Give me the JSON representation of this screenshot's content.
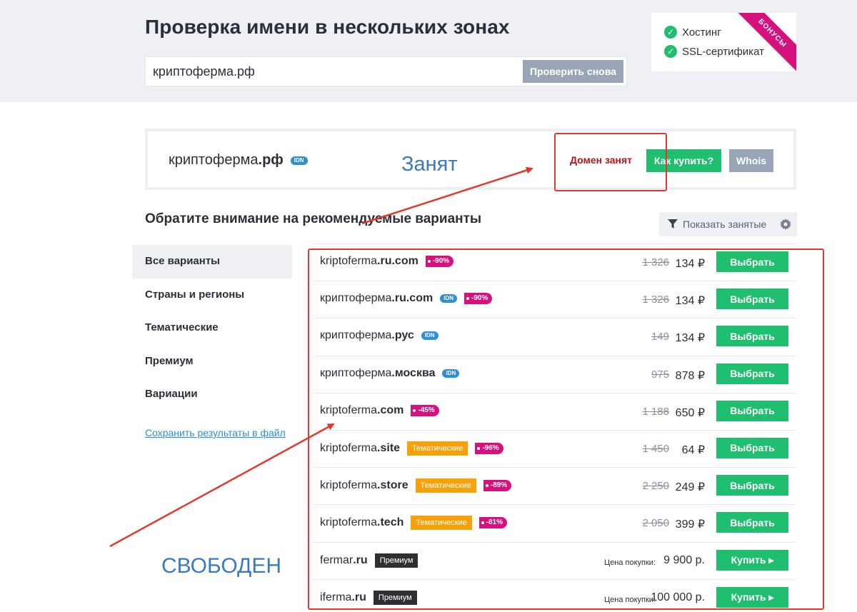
{
  "header": {
    "title": "Проверка имени в нескольких зонах",
    "search_value": "криптоферма.рф",
    "recheck_label": "Проверить снова"
  },
  "bonus": {
    "items": [
      "Хостинг",
      "SSL-сертификат"
    ],
    "ribbon": "БОНУСЫ"
  },
  "result": {
    "domain_name": "криптоферма",
    "domain_zone": ".рф",
    "idn": "IDN",
    "status": "Домен занят",
    "howbuy_label": "Как купить?",
    "whois_label": "Whois"
  },
  "recommend": {
    "title": "Обратите внимание на рекомендуемые варианты",
    "show_taken": "Показать занятые"
  },
  "sidebar": {
    "items": [
      "Все варианты",
      "Страны и регионы",
      "Тематические",
      "Премиум",
      "Вариации"
    ],
    "save_link": "Сохранить результаты в файл"
  },
  "rows": [
    {
      "name": "kriptoferma",
      "zone": ".ru.com",
      "tags": [
        {
          "type": "disc",
          "text": "-90%"
        }
      ],
      "old": "1 326",
      "price": "134 ₽",
      "btn": "Выбрать"
    },
    {
      "name": "криптоферма",
      "zone": ".ru.com",
      "tags": [
        {
          "type": "idn2",
          "text": "IDN"
        },
        {
          "type": "disc",
          "text": "-90%"
        }
      ],
      "old": "1 326",
      "price": "134 ₽",
      "btn": "Выбрать"
    },
    {
      "name": "криптоферма",
      "zone": ".рус",
      "tags": [
        {
          "type": "idn2",
          "text": "IDN"
        }
      ],
      "old": "149",
      "price": "134 ₽",
      "btn": "Выбрать"
    },
    {
      "name": "криптоферма",
      "zone": ".москва",
      "tags": [
        {
          "type": "idn2",
          "text": "IDN"
        }
      ],
      "old": "975",
      "price": "878 ₽",
      "btn": "Выбрать"
    },
    {
      "name": "kriptoferma",
      "zone": ".com",
      "tags": [
        {
          "type": "disc",
          "text": "-45%"
        }
      ],
      "old": "1 188",
      "price": "650 ₽",
      "btn": "Выбрать"
    },
    {
      "name": "kriptoferma",
      "zone": ".site",
      "tags": [
        {
          "type": "theme",
          "text": "Тематические"
        },
        {
          "type": "disc",
          "text": "-96%"
        }
      ],
      "old": "1 450",
      "price": "64 ₽",
      "btn": "Выбрать"
    },
    {
      "name": "kriptoferma",
      "zone": ".store",
      "tags": [
        {
          "type": "theme",
          "text": "Тематические"
        },
        {
          "type": "disc",
          "text": "-89%"
        }
      ],
      "old": "2 250",
      "price": "249 ₽",
      "btn": "Выбрать"
    },
    {
      "name": "kriptoferma",
      "zone": ".tech",
      "tags": [
        {
          "type": "theme",
          "text": "Тематические"
        },
        {
          "type": "disc",
          "text": "-81%"
        }
      ],
      "old": "2 050",
      "price": "399 ₽",
      "btn": "Выбрать"
    },
    {
      "name": "fermar",
      "zone": ".ru",
      "tags": [
        {
          "type": "prem",
          "text": "Премиум"
        }
      ],
      "price_label": "Цена покупки:",
      "buy_price": "9 900 р.",
      "btn": "Купить ▸"
    },
    {
      "name": "iferma",
      "zone": ".ru",
      "tags": [
        {
          "type": "prem",
          "text": "Премиум"
        }
      ],
      "price_label": "Цена покупки:",
      "buy_price": "100 000 р.",
      "btn": "Купить ▸"
    }
  ],
  "annotations": {
    "taken": "Занят",
    "free": "СВОБОДЕН"
  },
  "colors": {
    "accent_green": "#1fbf6f",
    "discount_magenta": "#d6107e",
    "theme_orange": "#f9a10b",
    "annotation_red": "#e03a2f",
    "annotation_blue": "#3a7abf"
  }
}
